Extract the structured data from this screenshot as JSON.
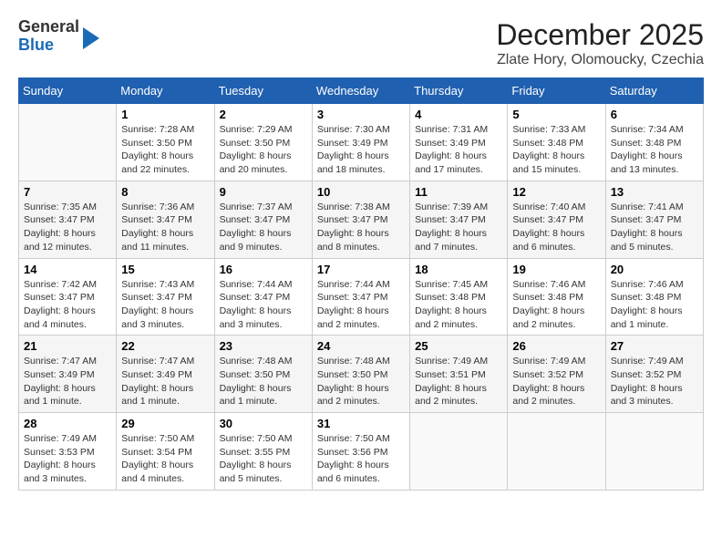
{
  "header": {
    "logo_general": "General",
    "logo_blue": "Blue",
    "title": "December 2025",
    "subtitle": "Zlate Hory, Olomoucky, Czechia"
  },
  "days_of_week": [
    "Sunday",
    "Monday",
    "Tuesday",
    "Wednesday",
    "Thursday",
    "Friday",
    "Saturday"
  ],
  "weeks": [
    [
      {
        "day": "",
        "info": ""
      },
      {
        "day": "1",
        "info": "Sunrise: 7:28 AM\nSunset: 3:50 PM\nDaylight: 8 hours\nand 22 minutes."
      },
      {
        "day": "2",
        "info": "Sunrise: 7:29 AM\nSunset: 3:50 PM\nDaylight: 8 hours\nand 20 minutes."
      },
      {
        "day": "3",
        "info": "Sunrise: 7:30 AM\nSunset: 3:49 PM\nDaylight: 8 hours\nand 18 minutes."
      },
      {
        "day": "4",
        "info": "Sunrise: 7:31 AM\nSunset: 3:49 PM\nDaylight: 8 hours\nand 17 minutes."
      },
      {
        "day": "5",
        "info": "Sunrise: 7:33 AM\nSunset: 3:48 PM\nDaylight: 8 hours\nand 15 minutes."
      },
      {
        "day": "6",
        "info": "Sunrise: 7:34 AM\nSunset: 3:48 PM\nDaylight: 8 hours\nand 13 minutes."
      }
    ],
    [
      {
        "day": "7",
        "info": "Sunrise: 7:35 AM\nSunset: 3:47 PM\nDaylight: 8 hours\nand 12 minutes."
      },
      {
        "day": "8",
        "info": "Sunrise: 7:36 AM\nSunset: 3:47 PM\nDaylight: 8 hours\nand 11 minutes."
      },
      {
        "day": "9",
        "info": "Sunrise: 7:37 AM\nSunset: 3:47 PM\nDaylight: 8 hours\nand 9 minutes."
      },
      {
        "day": "10",
        "info": "Sunrise: 7:38 AM\nSunset: 3:47 PM\nDaylight: 8 hours\nand 8 minutes."
      },
      {
        "day": "11",
        "info": "Sunrise: 7:39 AM\nSunset: 3:47 PM\nDaylight: 8 hours\nand 7 minutes."
      },
      {
        "day": "12",
        "info": "Sunrise: 7:40 AM\nSunset: 3:47 PM\nDaylight: 8 hours\nand 6 minutes."
      },
      {
        "day": "13",
        "info": "Sunrise: 7:41 AM\nSunset: 3:47 PM\nDaylight: 8 hours\nand 5 minutes."
      }
    ],
    [
      {
        "day": "14",
        "info": "Sunrise: 7:42 AM\nSunset: 3:47 PM\nDaylight: 8 hours\nand 4 minutes."
      },
      {
        "day": "15",
        "info": "Sunrise: 7:43 AM\nSunset: 3:47 PM\nDaylight: 8 hours\nand 3 minutes."
      },
      {
        "day": "16",
        "info": "Sunrise: 7:44 AM\nSunset: 3:47 PM\nDaylight: 8 hours\nand 3 minutes."
      },
      {
        "day": "17",
        "info": "Sunrise: 7:44 AM\nSunset: 3:47 PM\nDaylight: 8 hours\nand 2 minutes."
      },
      {
        "day": "18",
        "info": "Sunrise: 7:45 AM\nSunset: 3:48 PM\nDaylight: 8 hours\nand 2 minutes."
      },
      {
        "day": "19",
        "info": "Sunrise: 7:46 AM\nSunset: 3:48 PM\nDaylight: 8 hours\nand 2 minutes."
      },
      {
        "day": "20",
        "info": "Sunrise: 7:46 AM\nSunset: 3:48 PM\nDaylight: 8 hours\nand 1 minute."
      }
    ],
    [
      {
        "day": "21",
        "info": "Sunrise: 7:47 AM\nSunset: 3:49 PM\nDaylight: 8 hours\nand 1 minute."
      },
      {
        "day": "22",
        "info": "Sunrise: 7:47 AM\nSunset: 3:49 PM\nDaylight: 8 hours\nand 1 minute."
      },
      {
        "day": "23",
        "info": "Sunrise: 7:48 AM\nSunset: 3:50 PM\nDaylight: 8 hours\nand 1 minute."
      },
      {
        "day": "24",
        "info": "Sunrise: 7:48 AM\nSunset: 3:50 PM\nDaylight: 8 hours\nand 2 minutes."
      },
      {
        "day": "25",
        "info": "Sunrise: 7:49 AM\nSunset: 3:51 PM\nDaylight: 8 hours\nand 2 minutes."
      },
      {
        "day": "26",
        "info": "Sunrise: 7:49 AM\nSunset: 3:52 PM\nDaylight: 8 hours\nand 2 minutes."
      },
      {
        "day": "27",
        "info": "Sunrise: 7:49 AM\nSunset: 3:52 PM\nDaylight: 8 hours\nand 3 minutes."
      }
    ],
    [
      {
        "day": "28",
        "info": "Sunrise: 7:49 AM\nSunset: 3:53 PM\nDaylight: 8 hours\nand 3 minutes."
      },
      {
        "day": "29",
        "info": "Sunrise: 7:50 AM\nSunset: 3:54 PM\nDaylight: 8 hours\nand 4 minutes."
      },
      {
        "day": "30",
        "info": "Sunrise: 7:50 AM\nSunset: 3:55 PM\nDaylight: 8 hours\nand 5 minutes."
      },
      {
        "day": "31",
        "info": "Sunrise: 7:50 AM\nSunset: 3:56 PM\nDaylight: 8 hours\nand 6 minutes."
      },
      {
        "day": "",
        "info": ""
      },
      {
        "day": "",
        "info": ""
      },
      {
        "day": "",
        "info": ""
      }
    ]
  ]
}
